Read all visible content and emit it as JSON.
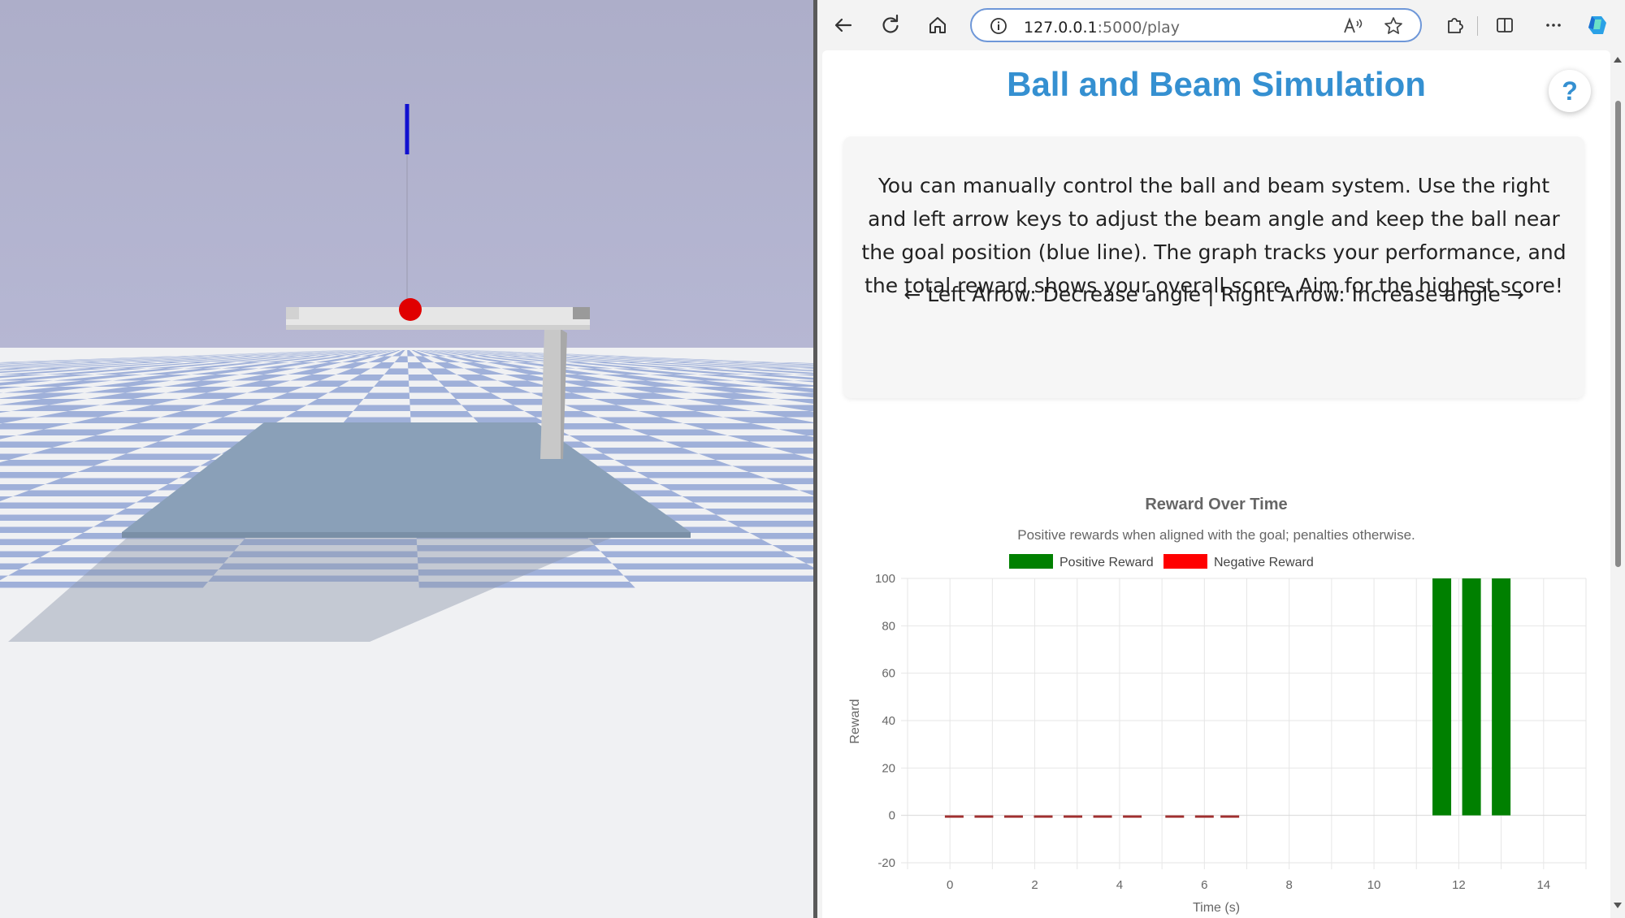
{
  "browser": {
    "url_host": "127.0.0.1",
    "url_path": ":5000/play"
  },
  "page": {
    "title": "Ball and Beam Simulation",
    "help_label": "?",
    "description": "You can manually control the ball and beam system. Use the right and left arrow keys to adjust the beam angle and keep the ball near the goal position (blue line). The graph tracks your performance, and the total reward shows your overall score. Aim for the highest score!",
    "controls": "← Left Arrow: Decrease angle | Right Arrow: Increase angle →"
  },
  "colors": {
    "title": "#3590d1",
    "positive": "#008000",
    "negative": "#ff0000",
    "goal_line": "#1010d0",
    "ball": "#e00000"
  },
  "chart_data": {
    "type": "bar",
    "title": "Reward Over Time",
    "subtitle": "Positive rewards when aligned with the goal; penalties otherwise.",
    "xlabel": "Time (s)",
    "ylabel": "Reward",
    "xlim": [
      -1,
      15
    ],
    "ylim": [
      -20,
      100
    ],
    "x_ticks": [
      0,
      2,
      4,
      6,
      8,
      10,
      12,
      14
    ],
    "y_ticks": [
      -20,
      0,
      20,
      40,
      60,
      80,
      100
    ],
    "grid": true,
    "legend_position": "top-center",
    "series": [
      {
        "name": "Positive Reward",
        "color": "#008000",
        "x": [
          11.6,
          12.3,
          13.0
        ],
        "values": [
          100,
          100,
          100
        ]
      },
      {
        "name": "Negative Reward",
        "color": "#ff0000",
        "x": [
          0.1,
          0.8,
          1.5,
          2.2,
          2.9,
          3.6,
          4.3,
          5.3,
          6.0,
          6.6
        ],
        "values": [
          -1,
          -1,
          -1,
          -1,
          -1,
          -1,
          -1,
          -1,
          -1,
          -1
        ]
      }
    ]
  }
}
